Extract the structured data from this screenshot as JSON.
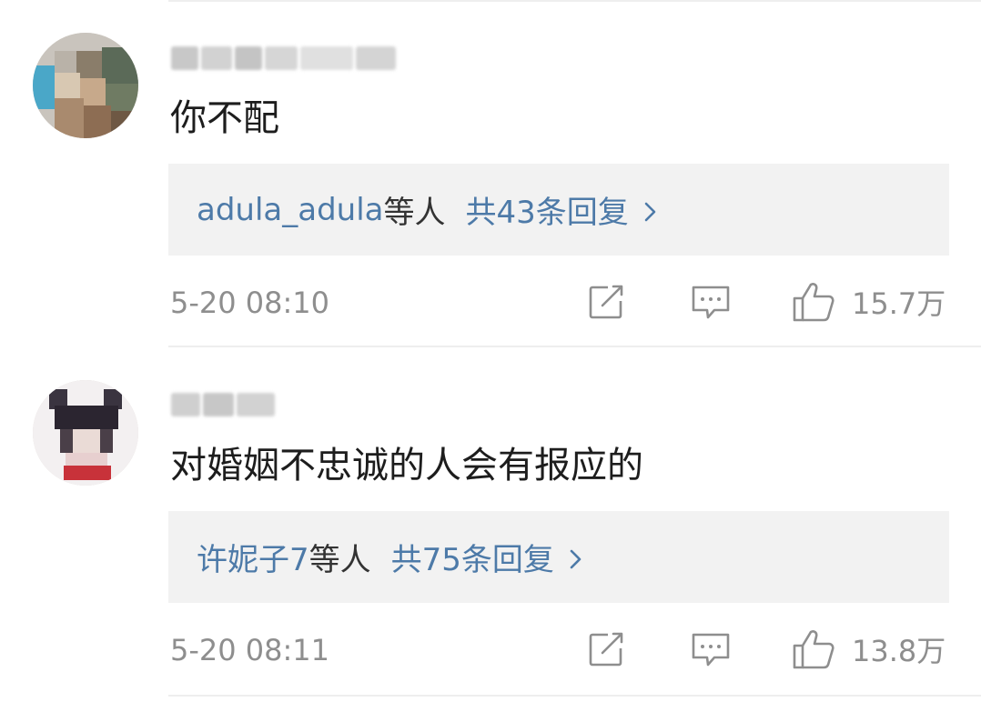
{
  "comments": [
    {
      "text": "你不配",
      "reply_names": "adula_adula",
      "reply_suffix": "等人",
      "reply_total": "共43条回复",
      "timestamp": "5-20 08:10",
      "like_count": "15.7万"
    },
    {
      "text": "对婚姻不忠诚的人会有报应的",
      "reply_names": "许妮子7",
      "reply_suffix": "等人",
      "reply_total": "共75条回复",
      "timestamp": "5-20 08:11",
      "like_count": "13.8万"
    }
  ],
  "icons": {
    "share": "share-icon",
    "comment": "comment-icon",
    "like": "thumbs-up-icon",
    "chevron": "chevron-right-icon"
  },
  "colors": {
    "link": "#4d7aa8",
    "meta": "#8e8e8e",
    "reply_bg": "#f2f2f2",
    "text": "#1d1d1d"
  }
}
